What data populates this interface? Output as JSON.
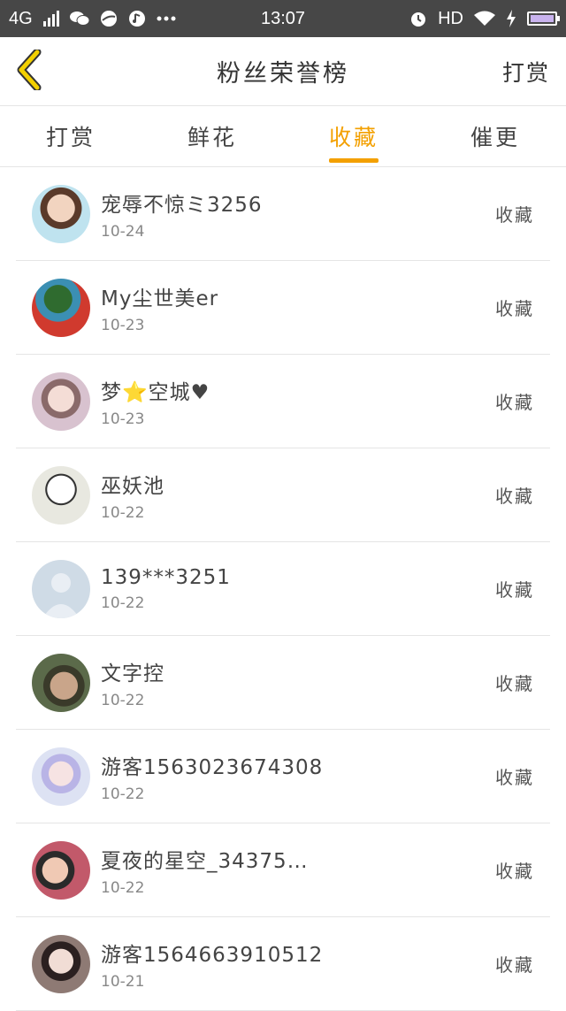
{
  "status_bar": {
    "network": "4G",
    "time": "13:07",
    "hd": "HD",
    "icons": [
      "wechat-icon",
      "browser-icon",
      "music-icon",
      "more-dots-icon",
      "alarm-icon",
      "wifi-icon",
      "charging-icon",
      "battery-icon"
    ]
  },
  "header": {
    "title": "粉丝荣誉榜",
    "action": "打赏",
    "back_icon": "chevron-left-icon",
    "accent_color": "#f3c000"
  },
  "tabs": [
    {
      "label": "打赏",
      "active": false
    },
    {
      "label": "鲜花",
      "active": false
    },
    {
      "label": "收藏",
      "active": true
    },
    {
      "label": "催更",
      "active": false
    }
  ],
  "accent_color": "#f3a000",
  "list": [
    {
      "name": "宠辱不惊ミ3256",
      "date": "10-24",
      "action": "收藏",
      "avatar_color": "#bfe3ef"
    },
    {
      "name": "My尘世美er",
      "date": "10-23",
      "action": "收藏",
      "avatar_color": "#d03a2e"
    },
    {
      "name": "梦⭐空城♥",
      "date": "10-23",
      "action": "收藏",
      "avatar_color": "#d8c2cf"
    },
    {
      "name": "巫妖池",
      "date": "10-22",
      "action": "收藏",
      "avatar_color": "#e8e8e0"
    },
    {
      "name": "139***3251",
      "date": "10-22",
      "action": "收藏",
      "avatar_color": "#cfdbe6"
    },
    {
      "name": "文字控",
      "date": "10-22",
      "action": "收藏",
      "avatar_color": "#5b6a4a"
    },
    {
      "name": "游客1563023674308",
      "date": "10-22",
      "action": "收藏",
      "avatar_color": "#dde2f3"
    },
    {
      "name": "夏夜的星空_34375…",
      "date": "10-22",
      "action": "收藏",
      "avatar_color": "#c2596a"
    },
    {
      "name": "游客1564663910512",
      "date": "10-21",
      "action": "收藏",
      "avatar_color": "#8e7a74"
    }
  ]
}
